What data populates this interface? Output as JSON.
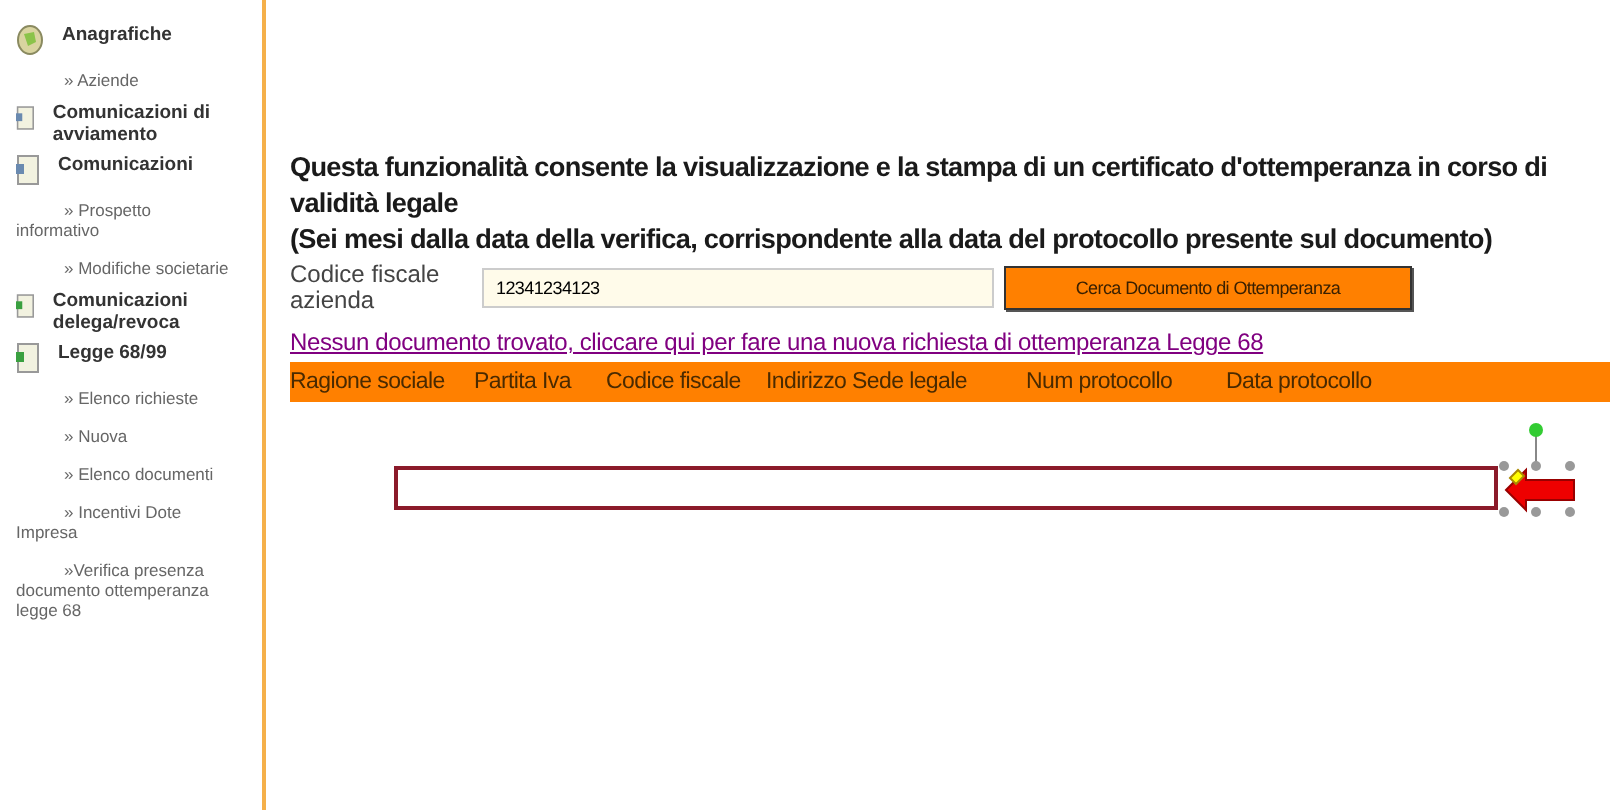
{
  "sidebar": {
    "items": [
      {
        "kind": "section",
        "label": "Anagrafiche"
      },
      {
        "kind": "link",
        "label": "» Aziende"
      },
      {
        "kind": "section",
        "label": "Comunicazioni di avviamento"
      },
      {
        "kind": "section",
        "label": "Comunicazioni"
      },
      {
        "kind": "link",
        "label": "» Prospetto informativo"
      },
      {
        "kind": "link",
        "label": "» Modifiche societarie"
      },
      {
        "kind": "section",
        "label": "Comunicazioni delega/revoca"
      },
      {
        "kind": "section",
        "label": "Legge 68/99"
      },
      {
        "kind": "link",
        "label": "» Elenco richieste"
      },
      {
        "kind": "link",
        "label": "» Nuova"
      },
      {
        "kind": "link",
        "label": "» Elenco documenti"
      },
      {
        "kind": "link",
        "label": "» Incentivi Dote Impresa"
      },
      {
        "kind": "link",
        "label": "»Verifica presenza documento ottemperanza legge 68"
      }
    ]
  },
  "main": {
    "heading": [
      "Questa funzionalità consente la visualizzazione e la stampa di un certificato d'ottemperanza in corso di validità legale",
      "(Sei mesi dalla data della verifica, corrispondente alla data del protocollo presente sul documento)"
    ],
    "form": {
      "label": "Codice fiscale azienda",
      "value": "12341234123",
      "button": "Cerca Documento di Ottemperanza"
    },
    "message_link": "Nessun documento trovato, cliccare qui per fare una nuova richiesta di ottemperanza Legge 68",
    "table": {
      "columns": [
        "Ragione sociale",
        "Partita Iva",
        "Codice fiscale",
        "Indirizzo Sede legale",
        "Num protocollo",
        "Data protocollo"
      ]
    }
  }
}
